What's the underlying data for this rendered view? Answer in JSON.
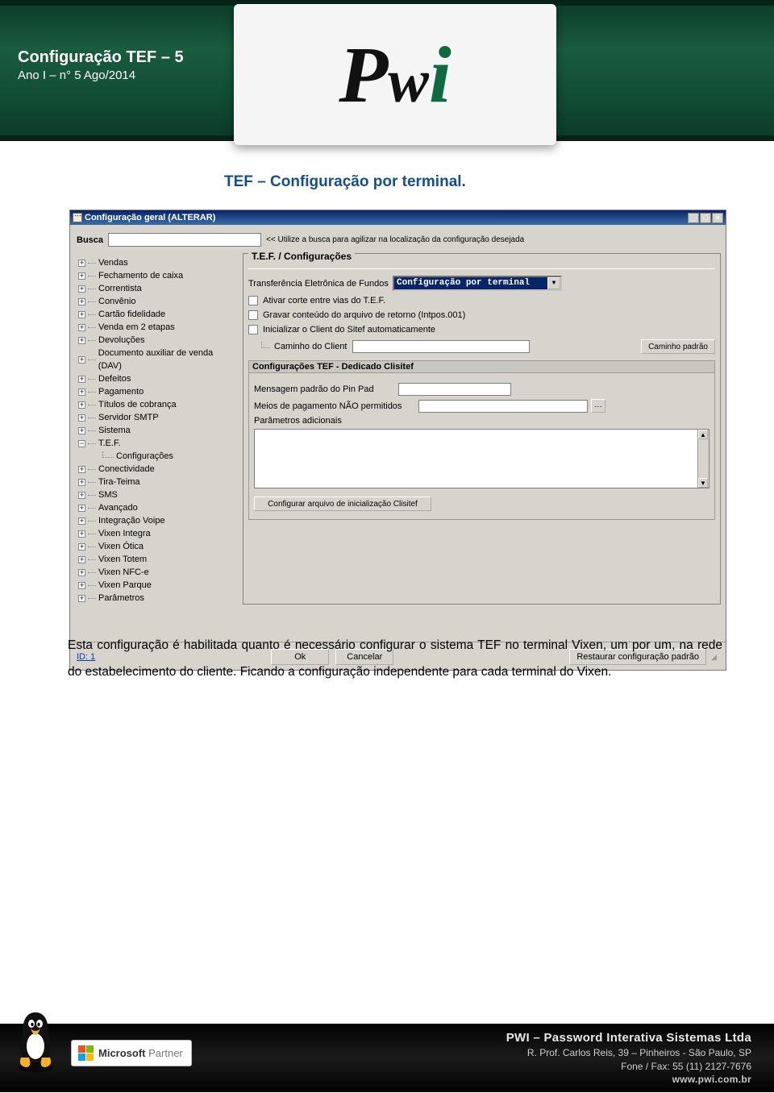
{
  "header": {
    "title": "Configuração TEF – 5",
    "subtitle": "Ano I – n° 5 Ago/2014",
    "logo_p": "P",
    "logo_w": "w",
    "logo_i": "i"
  },
  "section_heading": "TEF – Configuração por terminal.",
  "window": {
    "title": "Configuração geral (ALTERAR)",
    "busca_label": "Busca",
    "busca_hint": "<< Utilize a busca para agilizar na localização da configuração desejada",
    "tree_items": [
      "Vendas",
      "Fechamento de caixa",
      "Correntista",
      "Convênio",
      "Cartão fidelidade",
      "Venda em 2 etapas",
      "Devoluções",
      "Documento auxiliar de venda (DAV)",
      "Defeitos",
      "Pagamento",
      "Títulos de cobrança",
      "Servidor SMTP",
      "Sistema"
    ],
    "tree_tef": "T.E.F.",
    "tree_tef_child": "Configurações",
    "tree_items_after": [
      "Conectividade",
      "Tira-Teima",
      "SMS",
      "Avançado",
      "Integração Voipe",
      "Vixen Integra",
      "Vixen Ótica",
      "Vixen Totem",
      "Vixen NFC-e",
      "Vixen Parque",
      "Parâmetros"
    ],
    "panel_heading": "T.E.F. / Configurações",
    "fields": {
      "tef_label": "Transferência Eletrônica de Fundos",
      "tef_select_value": "Configuração por terminal",
      "chk_ativar": "Ativar corte entre vias do T.E.F.",
      "chk_gravar": "Gravar conteúdo do arquivo de retorno (Intpos.001)",
      "chk_inicializar": "Inicializar o Client do Sitef automaticamente",
      "caminho_client_label": "Caminho do Client",
      "caminho_padrao_btn": "Caminho padrão",
      "subsection_title": "Configurações TEF - Dedicado Clisitef",
      "msg_pinpad_label": "Mensagem padrão do Pin Pad",
      "meios_label": "Meios de pagamento NÃO permitidos",
      "params_label": "Parâmetros adicionais",
      "config_clisitef_btn": "Configurar arquivo de inicialização Clisitef"
    },
    "buttons": {
      "ok": "Ok",
      "cancelar": "Cancelar",
      "restaurar": "Restaurar configuração padrão"
    },
    "id_label": "ID: 1"
  },
  "paragraph": "Esta configuração é habilitada quanto é necessário configurar o sistema TEF no terminal Vixen, um por um, na rede do estabelecimento do cliente. Ficando a configuração independente para cada terminal do Vixen.",
  "footer": {
    "ms_partner": "Microsoft Partner",
    "ms_word": "Microsoft",
    "partner_word": "Partner",
    "company": "PWI – Password Interativa Sistemas Ltda",
    "addr": "R. Prof. Carlos Reis, 39 – Pinheiros - São Paulo, SP",
    "phone": "Fone / Fax: 55 (11) 2127-7676",
    "site": "www.pwi.com.br"
  }
}
